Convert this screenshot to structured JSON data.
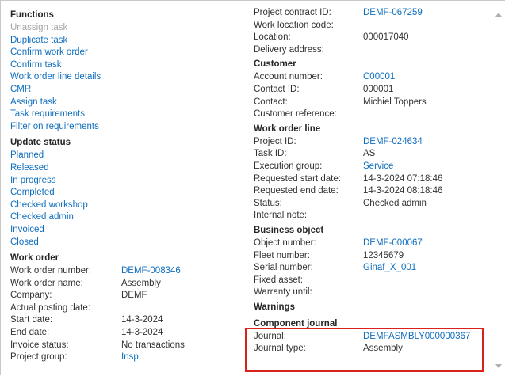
{
  "functions": {
    "title": "Functions",
    "items": [
      {
        "label": "Unassign task",
        "enabled": false
      },
      {
        "label": "Duplicate task",
        "enabled": true
      },
      {
        "label": "Confirm work order",
        "enabled": true
      },
      {
        "label": "Confirm task",
        "enabled": true
      },
      {
        "label": "Work order line details",
        "enabled": true
      },
      {
        "label": "CMR",
        "enabled": true
      },
      {
        "label": "Assign task",
        "enabled": true
      },
      {
        "label": "Task requirements",
        "enabled": true
      },
      {
        "label": "Filter on requirements",
        "enabled": true
      }
    ]
  },
  "update_status": {
    "title": "Update status",
    "items": [
      "Planned",
      "Released",
      "In progress",
      "Completed",
      "Checked workshop",
      "Checked admin",
      "Invoiced",
      "Closed"
    ]
  },
  "work_order": {
    "title": "Work order",
    "fields": [
      {
        "label": "Work order number:",
        "value": "DEMF-008346",
        "link": true
      },
      {
        "label": "Work order name:",
        "value": "Assembly",
        "link": false
      },
      {
        "label": "Company:",
        "value": "DEMF",
        "link": false
      },
      {
        "label": "Actual posting date:",
        "value": "",
        "link": false
      },
      {
        "label": "Start date:",
        "value": "14-3-2024",
        "link": false
      },
      {
        "label": "End date:",
        "value": "14-3-2024",
        "link": false
      },
      {
        "label": "Invoice status:",
        "value": "No transactions",
        "link": false
      },
      {
        "label": "Project group:",
        "value": "Insp",
        "link": true
      }
    ]
  },
  "project_top": {
    "fields": [
      {
        "label": "Project contract ID:",
        "value": "DEMF-067259",
        "link": true
      },
      {
        "label": "Work location code:",
        "value": "",
        "link": false
      },
      {
        "label": "Location:",
        "value": "000017040",
        "link": false
      },
      {
        "label": "Delivery address:",
        "value": "",
        "link": false
      }
    ]
  },
  "customer": {
    "title": "Customer",
    "fields": [
      {
        "label": "Account number:",
        "value": "C00001",
        "link": true
      },
      {
        "label": "Contact ID:",
        "value": "000001",
        "link": false
      },
      {
        "label": "Contact:",
        "value": "Michiel Toppers",
        "link": false
      },
      {
        "label": "Customer reference:",
        "value": "",
        "link": false
      }
    ]
  },
  "work_order_line": {
    "title": "Work order line",
    "fields": [
      {
        "label": "Project ID:",
        "value": "DEMF-024634",
        "link": true
      },
      {
        "label": "Task ID:",
        "value": "AS",
        "link": false
      },
      {
        "label": "Execution group:",
        "value": "Service",
        "link": true
      },
      {
        "label": "Requested start date:",
        "value": "14-3-2024 07:18:46",
        "link": false
      },
      {
        "label": "Requested end date:",
        "value": "14-3-2024 08:18:46",
        "link": false
      },
      {
        "label": "Status:",
        "value": "Checked admin",
        "link": false
      },
      {
        "label": "Internal note:",
        "value": "",
        "link": false
      }
    ]
  },
  "business_object": {
    "title": "Business object",
    "fields": [
      {
        "label": "Object number:",
        "value": "DEMF-000067",
        "link": true
      },
      {
        "label": "Fleet number:",
        "value": "12345679",
        "link": false
      },
      {
        "label": "Serial number:",
        "value": "Ginaf_X_001",
        "link": true
      },
      {
        "label": "Fixed asset:",
        "value": "",
        "link": false
      },
      {
        "label": "Warranty until:",
        "value": "",
        "link": false
      }
    ]
  },
  "warnings": {
    "title": "Warnings"
  },
  "component_journal": {
    "title": "Component journal",
    "fields": [
      {
        "label": "Journal:",
        "value": "DEMFASMBLY000000367",
        "link": true
      },
      {
        "label": "Journal type:",
        "value": "Assembly",
        "link": false
      }
    ]
  },
  "colors": {
    "link": "#106ebe",
    "disabled": "#a6a6a6",
    "highlight": "#d9221c"
  },
  "icons": {
    "scroll_up": "triangle-up-icon",
    "scroll_down": "triangle-down-icon"
  }
}
